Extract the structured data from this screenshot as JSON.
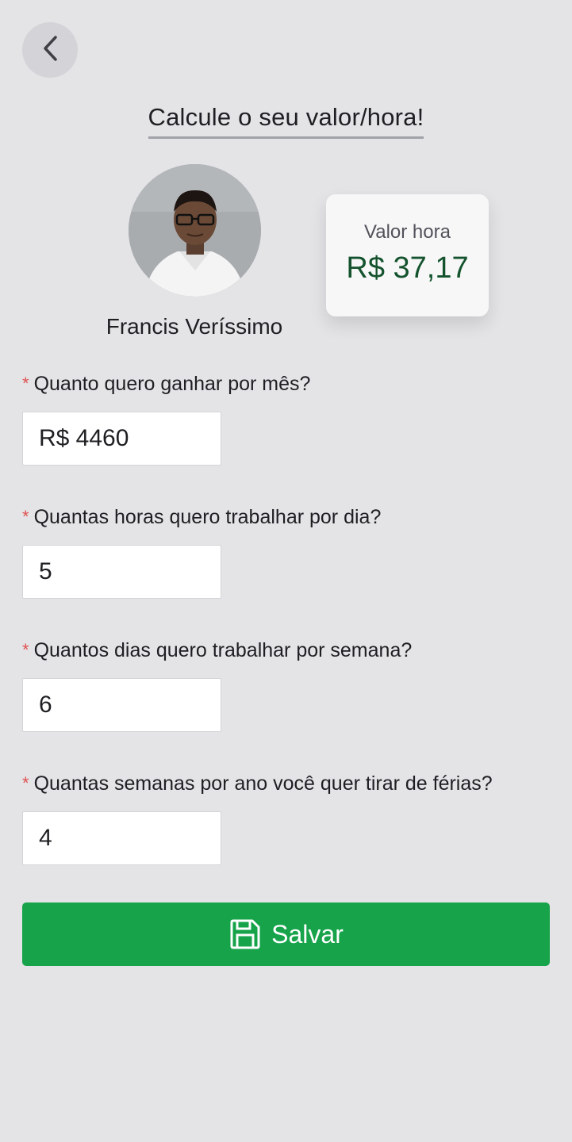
{
  "header": {
    "back_icon": "chevron-left-icon",
    "title": "Calcule o seu valor/hora!"
  },
  "profile": {
    "name": "Francis Veríssimo"
  },
  "rate": {
    "label": "Valor hora",
    "value": "R$ 37,17",
    "value_color": "#14532d"
  },
  "form": {
    "required_mark": "*",
    "monthly_income": {
      "label": "Quanto quero ganhar por mês?",
      "value": "R$ 4460"
    },
    "hours_per_day": {
      "label": "Quantas horas quero trabalhar por dia?",
      "value": "5"
    },
    "days_per_week": {
      "label": "Quantos dias quero trabalhar por semana?",
      "value": "6"
    },
    "vacation_weeks": {
      "label": "Quantas semanas por ano você quer tirar de férias?",
      "value": "4"
    }
  },
  "actions": {
    "save_label": "Salvar",
    "save_icon": "save-icon",
    "save_color": "#16a34a"
  },
  "colors": {
    "background": "#e4e4e7",
    "required": "#e05252"
  }
}
